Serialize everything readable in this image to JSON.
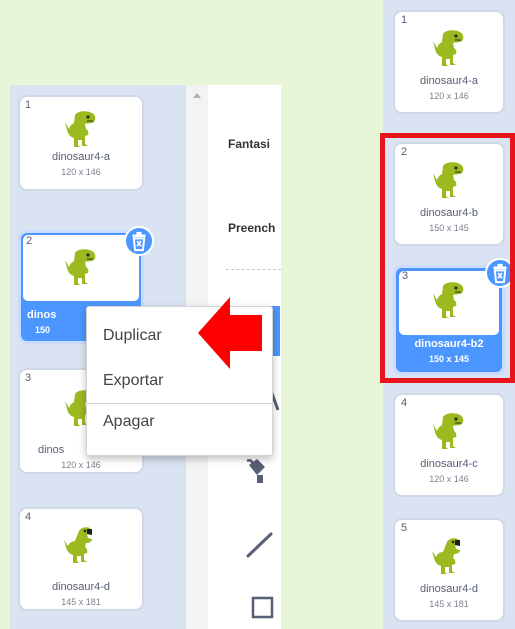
{
  "left_panel": {
    "costumes": [
      {
        "number": "1",
        "name": "dinosaur4-a",
        "size": "120 x 146"
      },
      {
        "number": "2",
        "name": "dinos",
        "size": "150"
      },
      {
        "number": "3",
        "name": "dinos",
        "size": "120 x 146"
      },
      {
        "number": "4",
        "name": "dinosaur4-d",
        "size": "145 x 181"
      }
    ]
  },
  "paint_editor": {
    "fill_label": "Fantasi",
    "outline_label": "Preench"
  },
  "context_menu": {
    "items": [
      "Duplicar",
      "Exportar",
      "Apagar"
    ]
  },
  "right_panel": {
    "costumes": [
      {
        "number": "1",
        "name": "dinosaur4-a",
        "size": "120 x 146"
      },
      {
        "number": "2",
        "name": "dinosaur4-b",
        "size": "150 x 145"
      },
      {
        "number": "3",
        "name": "dinosaur4-b2",
        "size": "150 x 145"
      },
      {
        "number": "4",
        "name": "dinosaur4-c",
        "size": "120 x 146"
      },
      {
        "number": "5",
        "name": "dinosaur4-d",
        "size": "145 x 181"
      }
    ]
  },
  "colors": {
    "accent": "#4c97ff",
    "highlight": "#e8141c",
    "arrow": "#ff0000",
    "dino": "#9bba1f",
    "background": "#e9f5d9",
    "panel": "#d9e3f2"
  }
}
